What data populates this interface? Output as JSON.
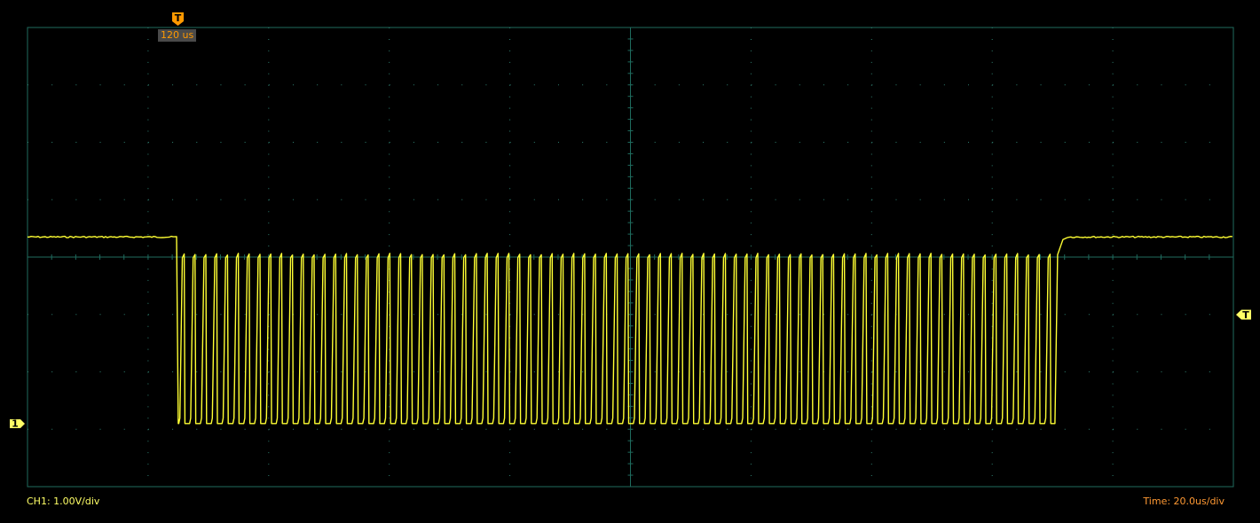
{
  "scope": {
    "channel_scale_label": "CH1: 1.00V/div",
    "time_scale_label": "Time: 20.0us/div",
    "trigger_time_label": "120 us",
    "trigger_marker_glyph": "T",
    "trigger_level_glyph": "T",
    "channel_marker_glyph": "1"
  },
  "colors": {
    "background": "#000000",
    "grid": "#1f6b5e",
    "grid_dots": "#2f7f70",
    "trace": "#ffff33",
    "channel_label": "#ffff66",
    "time_label": "#ff9933",
    "trigger": "#ff9900",
    "trigger_box": "#4a4a4a"
  },
  "icons": {
    "trigger_position": "trigger-marker-icon",
    "trigger_level": "trigger-level-icon",
    "channel_ground": "channel-1-marker-icon"
  },
  "chart_data": {
    "type": "line",
    "x_divisions": 10,
    "y_divisions": 8,
    "time_per_div_us": 20.0,
    "volts_per_div": 1.0,
    "grid": true,
    "series": [
      {
        "idle_high_level_div": 3.35,
        "pulse_high_level_div": 3.05,
        "low_level_div": 0.1,
        "burst_start_div": 1.25,
        "burst_end_div": 8.52,
        "pulse_count": 81
      }
    ]
  }
}
